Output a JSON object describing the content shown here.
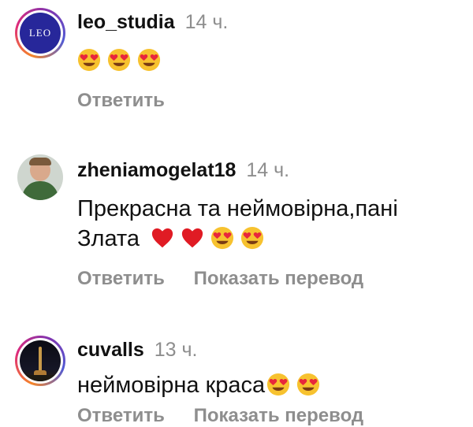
{
  "comments": [
    {
      "username": "leo_studia",
      "time": "14 ч.",
      "text": "",
      "emojis": [
        "heart-eyes-emoji",
        "heart-eyes-emoji",
        "heart-eyes-emoji"
      ],
      "avatar_text": "LEO",
      "reply_label": "Ответить"
    },
    {
      "username": "zheniamogelat18",
      "time": "14 ч.",
      "text_line1": "Прекрасна та неймовірна,пані",
      "text_line2": "Злата",
      "emojis": [
        "red-heart-emoji",
        "red-heart-emoji",
        "heart-eyes-emoji",
        "heart-eyes-emoji"
      ],
      "reply_label": "Ответить",
      "translate_label": "Показать перевод"
    },
    {
      "username": "cuvalls",
      "time": "13 ч.",
      "text": "неймовірна краса",
      "emojis": [
        "heart-eyes-emoji",
        "heart-eyes-emoji"
      ],
      "reply_label": "Ответить",
      "translate_label": "Показать перевод"
    }
  ],
  "colors": {
    "text": "#111111",
    "secondary": "#8e8e8e",
    "leo_logo_bg": "#27279a"
  }
}
